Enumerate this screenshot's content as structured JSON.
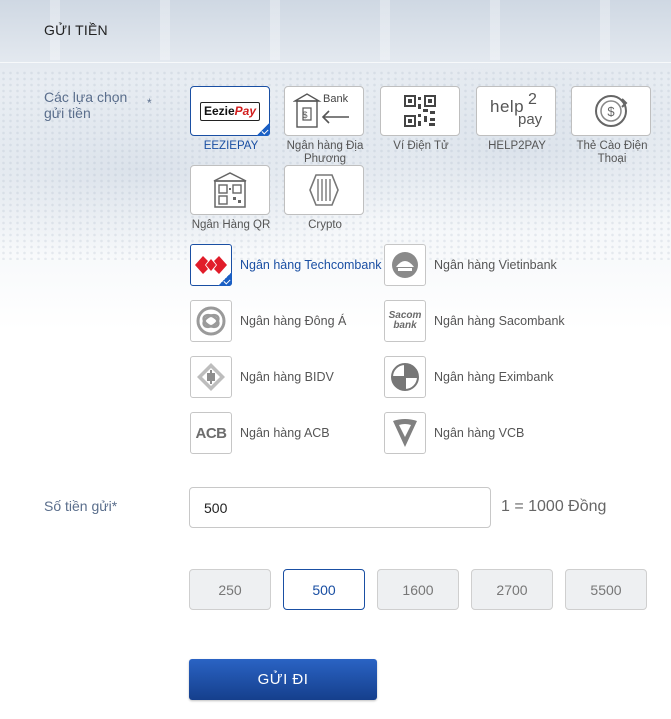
{
  "page": {
    "title": "GỬI TIỀN"
  },
  "methods": {
    "label": "Các lựa chọn gửi tiền",
    "required_mark": "*",
    "selected": "EEZIEPAY",
    "items": [
      {
        "label": "EEZIEPAY",
        "icon": "eeziepay-logo-icon",
        "logo_text": "Eezie",
        "logo_text2": "Pay"
      },
      {
        "label": "Ngân hàng Địa Phương",
        "icon": "local-bank-icon",
        "logo_text": "Bank"
      },
      {
        "label": "Ví Điện Tử",
        "icon": "qr-code-icon"
      },
      {
        "label": "HELP2PAY",
        "icon": "help2pay-logo-icon",
        "logo_text": "help",
        "logo_text2": "2",
        "logo_text3": "pay"
      },
      {
        "label": "Thẻ Cào Điện Thoại",
        "icon": "phone-card-icon"
      },
      {
        "label": "Ngân Hàng QR",
        "icon": "qr-bank-icon"
      },
      {
        "label": "Crypto",
        "icon": "crypto-icon"
      }
    ]
  },
  "banks": {
    "selected": "Ngân hàng Techcombank",
    "items": [
      {
        "label": "Ngân hàng Techcombank",
        "icon": "techcombank-logo-icon"
      },
      {
        "label": "Ngân hàng Vietinbank",
        "icon": "vietinbank-logo-icon"
      },
      {
        "label": "Ngân hàng Đông Á",
        "icon": "dongabank-logo-icon"
      },
      {
        "label": "Ngân hàng Sacombank",
        "icon": "sacombank-logo-icon",
        "logo_text": "Sacom",
        "logo_text2": "bank"
      },
      {
        "label": "Ngân hàng BIDV",
        "icon": "bidv-logo-icon"
      },
      {
        "label": "Ngân hàng Eximbank",
        "icon": "eximbank-logo-icon"
      },
      {
        "label": "Ngân hàng ACB",
        "icon": "acb-logo-icon",
        "logo_text": "ACB"
      },
      {
        "label": "Ngân hàng VCB",
        "icon": "vcb-logo-icon"
      }
    ]
  },
  "amount": {
    "label": "Số tiền gửi*",
    "value": "500",
    "rate_text": "1 = 1000 Đồng",
    "presets": [
      "250",
      "500",
      "1600",
      "2700",
      "5500"
    ],
    "selected_preset": "500"
  },
  "submit": {
    "label": "GỬI ĐI"
  },
  "colors": {
    "accent": "#1a4fa3",
    "label": "#5a6e8c",
    "button": "#1d4ea8"
  }
}
